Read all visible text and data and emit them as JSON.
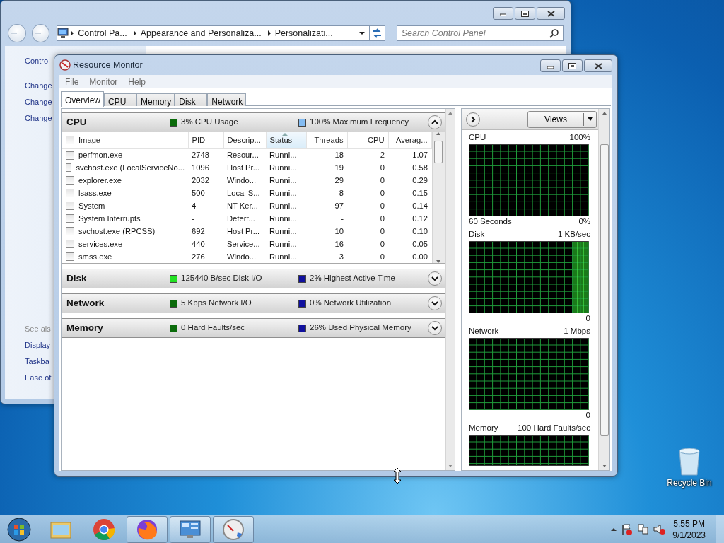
{
  "control_panel": {
    "breadcrumbs": [
      "Control Pa...",
      "Appearance and Personaliza...",
      "Personalizati..."
    ],
    "search_placeholder": "Search Control Panel",
    "links": [
      "Contro",
      "Change",
      "Change",
      "Change"
    ],
    "see_also_heading": "See als",
    "see_also": [
      "Display",
      "Taskba",
      "Ease of"
    ]
  },
  "resource_monitor": {
    "title": "Resource Monitor",
    "menu": [
      "File",
      "Monitor",
      "Help"
    ],
    "tabs": [
      {
        "label": "Overview",
        "selected": true
      },
      {
        "label": "CPU",
        "selected": false
      },
      {
        "label": "Memory",
        "selected": false
      },
      {
        "label": "Disk",
        "selected": false
      },
      {
        "label": "Network",
        "selected": false
      }
    ],
    "sections": [
      {
        "name": "CPU",
        "expanded": true,
        "legend": [
          {
            "text": "3% CPU Usage",
            "color": "#0b6b0b"
          },
          {
            "text": "100% Maximum Frequency",
            "color": "#84bcf2"
          }
        ]
      },
      {
        "name": "Disk",
        "expanded": false,
        "legend": [
          {
            "text": "125440 B/sec Disk I/O",
            "color": "#22e022"
          },
          {
            "text": "2% Highest Active Time",
            "color": "#10109e"
          }
        ]
      },
      {
        "name": "Network",
        "expanded": false,
        "legend": [
          {
            "text": "5 Kbps Network I/O",
            "color": "#0b6b0b"
          },
          {
            "text": "0% Network Utilization",
            "color": "#10109e"
          }
        ]
      },
      {
        "name": "Memory",
        "expanded": false,
        "legend": [
          {
            "text": "0 Hard Faults/sec",
            "color": "#0b6b0b"
          },
          {
            "text": "26% Used Physical Memory",
            "color": "#10109e"
          }
        ]
      }
    ],
    "cpu_table": {
      "select_all_checked": false,
      "columns": [
        {
          "label": "Image",
          "sorted": false
        },
        {
          "label": "PID",
          "sorted": false
        },
        {
          "label": "Descrip...",
          "sorted": false
        },
        {
          "label": "Status",
          "sorted": true
        },
        {
          "label": "Threads",
          "sorted": false
        },
        {
          "label": "CPU",
          "sorted": false
        },
        {
          "label": "Averag...",
          "sorted": false
        }
      ],
      "rows": [
        {
          "checked": false,
          "cells": [
            "perfmon.exe",
            "2748",
            "Resour...",
            "Runni...",
            "18",
            "2",
            "1.07"
          ]
        },
        {
          "checked": false,
          "cells": [
            "svchost.exe (LocalServiceNo...",
            "1096",
            "Host Pr...",
            "Runni...",
            "19",
            "0",
            "0.58"
          ]
        },
        {
          "checked": false,
          "cells": [
            "explorer.exe",
            "2032",
            "Windo...",
            "Runni...",
            "29",
            "0",
            "0.29"
          ]
        },
        {
          "checked": false,
          "cells": [
            "lsass.exe",
            "500",
            "Local S...",
            "Runni...",
            "8",
            "0",
            "0.15"
          ]
        },
        {
          "checked": false,
          "cells": [
            "System",
            "4",
            "NT Ker...",
            "Runni...",
            "97",
            "0",
            "0.14"
          ]
        },
        {
          "checked": false,
          "cells": [
            "System Interrupts",
            "-",
            "Deferr...",
            "Runni...",
            "-",
            "0",
            "0.12"
          ]
        },
        {
          "checked": false,
          "cells": [
            "svchost.exe (RPCSS)",
            "692",
            "Host Pr...",
            "Runni...",
            "10",
            "0",
            "0.10"
          ]
        },
        {
          "checked": false,
          "cells": [
            "services.exe",
            "440",
            "Service...",
            "Runni...",
            "16",
            "0",
            "0.05"
          ]
        },
        {
          "checked": false,
          "cells": [
            "smss.exe",
            "276",
            "Windo...",
            "Runni...",
            "3",
            "0",
            "0.00"
          ]
        }
      ]
    },
    "graph_panel": {
      "views_label": "Views",
      "graphs": [
        {
          "name": "CPU",
          "max": "100%",
          "footer": "60 Seconds",
          "min": "0%"
        },
        {
          "name": "Disk",
          "max": "1 KB/sec",
          "min": "0"
        },
        {
          "name": "Network",
          "max": "1 Mbps",
          "min": "0"
        },
        {
          "name": "Memory",
          "max": "100 Hard Faults/sec"
        }
      ]
    }
  },
  "desktop_icons": [
    {
      "label": "Recycle Bin"
    }
  ],
  "taskbar": {
    "apps": [
      {
        "kind": "folder",
        "running": false
      },
      {
        "kind": "chrome",
        "running": false
      },
      {
        "kind": "firefox",
        "running": true
      },
      {
        "kind": "control-panel",
        "running": true
      },
      {
        "kind": "resource-monitor",
        "running": true
      }
    ],
    "clock": {
      "time": "5:55 PM",
      "date": "9/1/2023"
    }
  }
}
